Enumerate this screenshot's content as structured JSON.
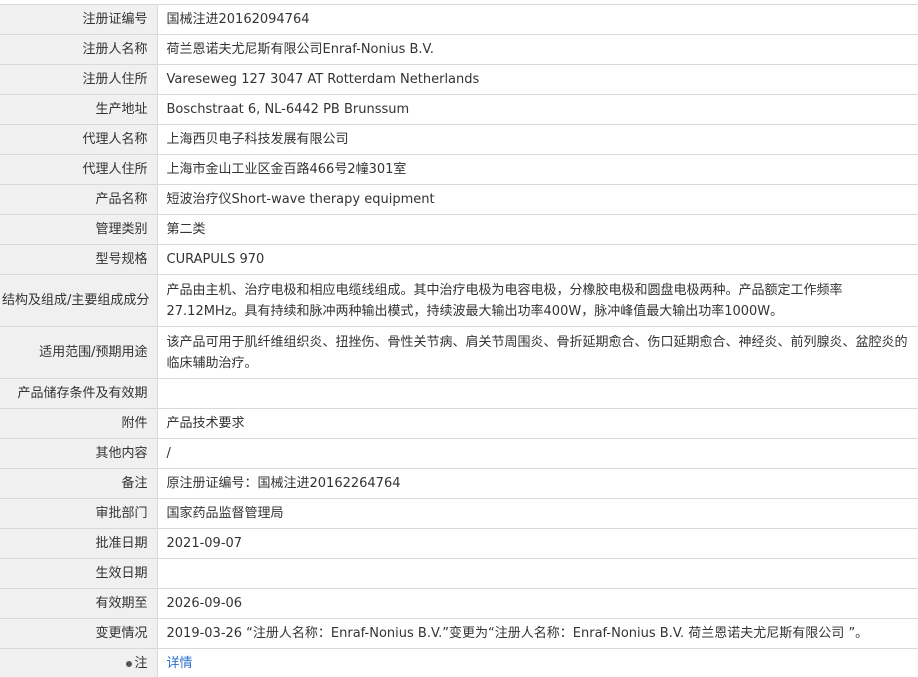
{
  "rows": [
    {
      "label": "注册证编号",
      "value": "国械注进20162094764"
    },
    {
      "label": "注册人名称",
      "value": "荷兰恩诺夫尤尼斯有限公司Enraf-Nonius B.V."
    },
    {
      "label": "注册人住所",
      "value": "Vareseweg 127 3047 AT Rotterdam Netherlands"
    },
    {
      "label": "生产地址",
      "value": "Boschstraat 6, NL-6442 PB Brunssum"
    },
    {
      "label": "代理人名称",
      "value": "上海西贝电子科技发展有限公司"
    },
    {
      "label": "代理人住所",
      "value": "上海市金山工业区金百路466号2幢301室"
    },
    {
      "label": "产品名称",
      "value": "短波治疗仪Short-wave therapy equipment"
    },
    {
      "label": "管理类别",
      "value": "第二类"
    },
    {
      "label": "型号规格",
      "value": "CURAPULS 970"
    },
    {
      "label": "结构及组成/主要组成成分",
      "value": "产品由主机、治疗电极和相应电缆线组成。其中治疗电极为电容电极，分橡胶电极和圆盘电极两种。产品额定工作频率27.12MHz。具有持续和脉冲两种输出模式，持续波最大输出功率400W，脉冲峰值最大输出功率1000W。"
    },
    {
      "label": "适用范围/预期用途",
      "value": "该产品可用于肌纤维组织炎、扭挫伤、骨性关节病、肩关节周围炎、骨折延期愈合、伤口延期愈合、神经炎、前列腺炎、盆腔炎的临床辅助治疗。"
    },
    {
      "label": "产品储存条件及有效期",
      "value": ""
    },
    {
      "label": "附件",
      "value": "产品技术要求"
    },
    {
      "label": "其他内容",
      "value": "/"
    },
    {
      "label": "备注",
      "value": "原注册证编号：国械注进20162264764"
    },
    {
      "label": "审批部门",
      "value": "国家药品监督管理局"
    },
    {
      "label": "批准日期",
      "value": "2021-09-07"
    },
    {
      "label": "生效日期",
      "value": ""
    },
    {
      "label": "有效期至",
      "value": "2026-09-06"
    },
    {
      "label": "变更情况",
      "value": "2019-03-26 “注册人名称：Enraf-Nonius B.V.”变更为“注册人名称：Enraf-Nonius B.V. 荷兰恩诺夫尤尼斯有限公司 ”。"
    }
  ],
  "note_row": {
    "label": "注",
    "value": "详情"
  }
}
